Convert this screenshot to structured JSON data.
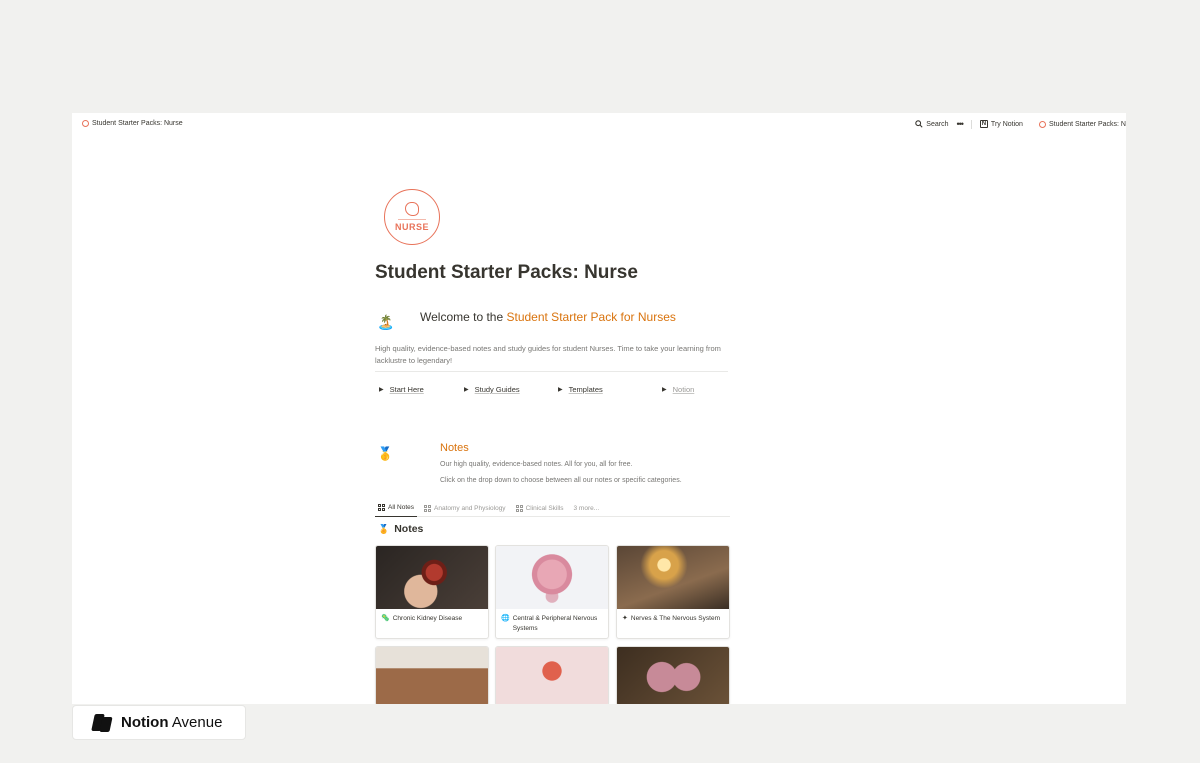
{
  "topbar": {
    "breadcrumb": "Student Starter Packs: Nurse",
    "search": "Search",
    "more": "•••",
    "try_notion": "Try Notion",
    "tab_title": "Student Starter Packs: N"
  },
  "page": {
    "logo_text": "NURSE",
    "title": "Student Starter Packs: Nurse",
    "welcome_prefix": "Welcome to the ",
    "welcome_highlight": "Student Starter Pack for Nurses",
    "description": "High quality, evidence-based notes and study guides for student Nurses. Time to take your learning from lacklustre to legendary!",
    "toggles": [
      {
        "label": "Start Here"
      },
      {
        "label": "Study Guides"
      },
      {
        "label": "Templates"
      },
      {
        "label": "Notion"
      }
    ]
  },
  "notes_section": {
    "heading": "Notes",
    "line1": "Our high quality, evidence-based notes. All for you, all for free.",
    "line2": "Click on the drop down to choose between all our notes or specific categories.",
    "tabs": [
      {
        "label": "All Notes"
      },
      {
        "label": "Anatomy and Physiology"
      },
      {
        "label": "Clinical Skills"
      },
      {
        "label": "3 more..."
      }
    ],
    "db_title": "Notes",
    "cards": [
      {
        "title": "Chronic Kidney Disease",
        "icon": "🦠"
      },
      {
        "title": "Central & Peripheral Nervous Systems",
        "icon": "🌐"
      },
      {
        "title": "Nerves & The Nervous System",
        "icon": "✦"
      }
    ]
  },
  "brand": {
    "name_bold": "Notion",
    "name_rest": " Avenue"
  },
  "colors": {
    "accent": "#d9730d",
    "logo": "#e8735a"
  }
}
